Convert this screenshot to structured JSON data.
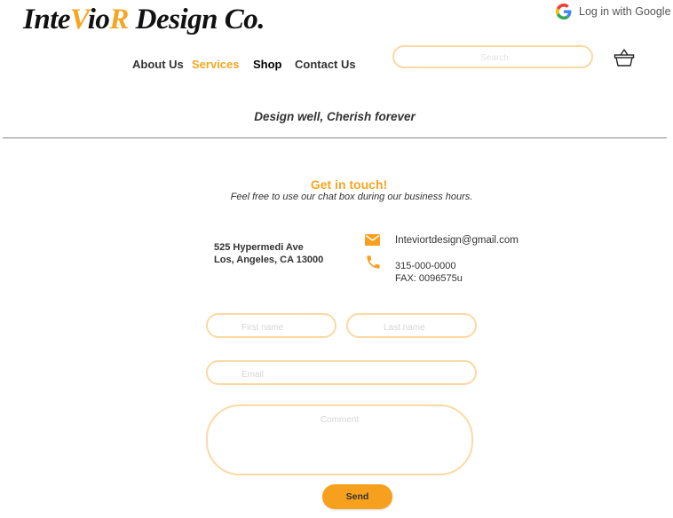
{
  "brand": {
    "logo_part1": "Inte",
    "logo_part2": "V",
    "logo_part3": "io",
    "logo_part4": "R",
    "logo_part5": " Design Co.",
    "accent_color": "#f5a623"
  },
  "auth": {
    "google_login_label": "Log in with Google",
    "icon": "google-g-icon"
  },
  "nav": {
    "about": "About Us",
    "services": "Services",
    "shop": "Shop",
    "contact": "Contact Us"
  },
  "search": {
    "placeholder": "Search",
    "value": ""
  },
  "cart": {
    "icon": "shopping-basket-icon"
  },
  "tagline": "Design well, Cherish forever",
  "contact": {
    "heading": "Get in touch!",
    "subheading": "Feel free to use our chat box during our business hours.",
    "address_line1": "525 Hypermedi Ave",
    "address_line2": "Los, Angeles, CA 13000",
    "email": "Inteviortdesign@gmail.com",
    "phone": "315-000-0000",
    "fax": "FAX: 0096575u",
    "mail_icon": "envelope-icon",
    "phone_icon": "phone-icon"
  },
  "form": {
    "first_name_placeholder": "First name",
    "last_name_placeholder": "Last name",
    "email_placeholder": "Email",
    "comment_placeholder": "Comment",
    "send_label": "Send"
  }
}
